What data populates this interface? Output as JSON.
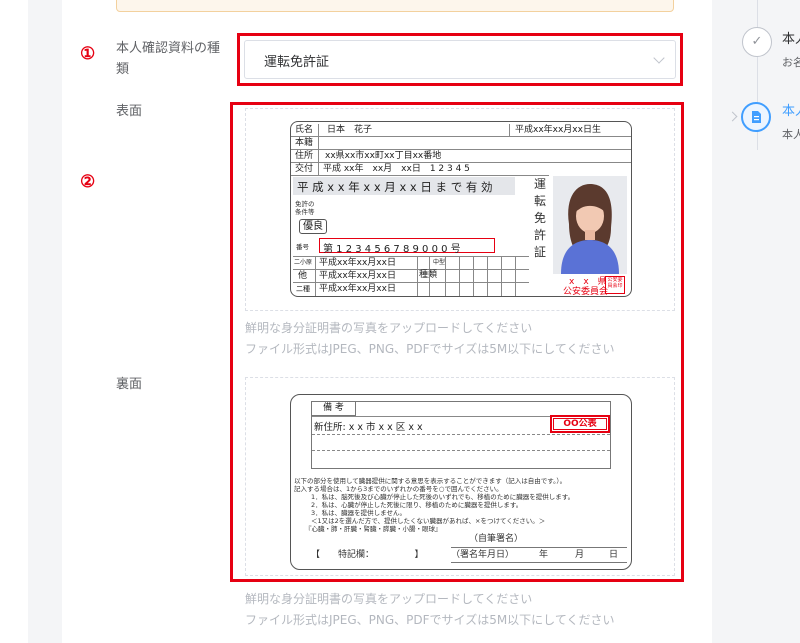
{
  "form": {
    "marker_1": "①",
    "marker_2": "②",
    "doc_type_label_line1": "本人確認資料の種",
    "doc_type_label_line2": "類",
    "doc_type_value": "運転免許証",
    "front_label": "表面",
    "back_label": "裏面",
    "hint_line1": "鮮明な身分証明書の写真をアップロードしてください",
    "hint_line2": "ファイル形式はJPEG、PNG、PDFでサイズは5M以下にしてください"
  },
  "license_front": {
    "name_label": "氏名",
    "name_value": "日本　花子",
    "birth_value": "平成xx年xx月xx日生",
    "honseki_label": "本籍",
    "address_label": "住所",
    "address_value": "xx県xx市xx町xx丁目xx番地",
    "issue_label": "交付",
    "issue_value": "平成 xx年　xx月　xx日　1 2 3 4 5",
    "valid_until": "平 成 x x 年 x x 月 x x 日 ま で 有 効",
    "conditions_label_line1": "免許の",
    "conditions_label_line2": "条件等",
    "excellent_badge": "優良",
    "number_label": "番号",
    "number_value": "第 1 2 3 4 5 6 7 8 9 0 0 0 号",
    "class_row1_label": "二小原",
    "class_row2_label": "他",
    "class_row3_label": "二種",
    "date_row": "平成xx年xx月xx日",
    "kind_label": "種類",
    "chugata_label": "中型",
    "vertical_title_chars": [
      "運",
      "転",
      "免",
      "許",
      "証"
    ],
    "issuer_line1": "x　x　県",
    "issuer_line2": "公安委員会",
    "seal_text": "公安委員会印"
  },
  "license_back": {
    "remarks_label": "備 考",
    "new_address": "新住所:  x x 市 x x 区 x x",
    "stamp_text": "OO公表",
    "donor_text_1": "以下の部分を使用して臓器提供に関する意思を表示することができます（記入は自由です。）。",
    "donor_text_2": "記入する場合は、1から3までのいずれかの番号を○で囲んでください。",
    "donor_text_3": "1．私は、脳死後及び心臓が停止した死後のいずれでも、移植のために臓器を提供します。",
    "donor_text_4": "2．私は、心臓が停止した死後に限り、移植のために臓器を提供します。",
    "donor_text_5": "3．私は、臓器を提供しません。",
    "donor_text_6": "＜1又は2を選んだ方で、提供したくない臓器があれば、×をつけてください。＞",
    "donor_text_7": "『心臓・肺・肝臓・腎臓・膵臓・小腸・眼球』",
    "signature_label": "（自筆署名）",
    "special_label": "【　　特記欄：　　　　　】",
    "sign_date_label": "（署名年月日）",
    "year_label": "年",
    "month_label": "月",
    "day_label": "日"
  },
  "timeline": {
    "step1_title": "本人",
    "step1_sub": "お名",
    "step2_title": "本人",
    "step2_sub": "本人",
    "check_icon": "✓"
  },
  "colors": {
    "annotation_red": "#e60012",
    "primary_blue": "#409eff"
  }
}
